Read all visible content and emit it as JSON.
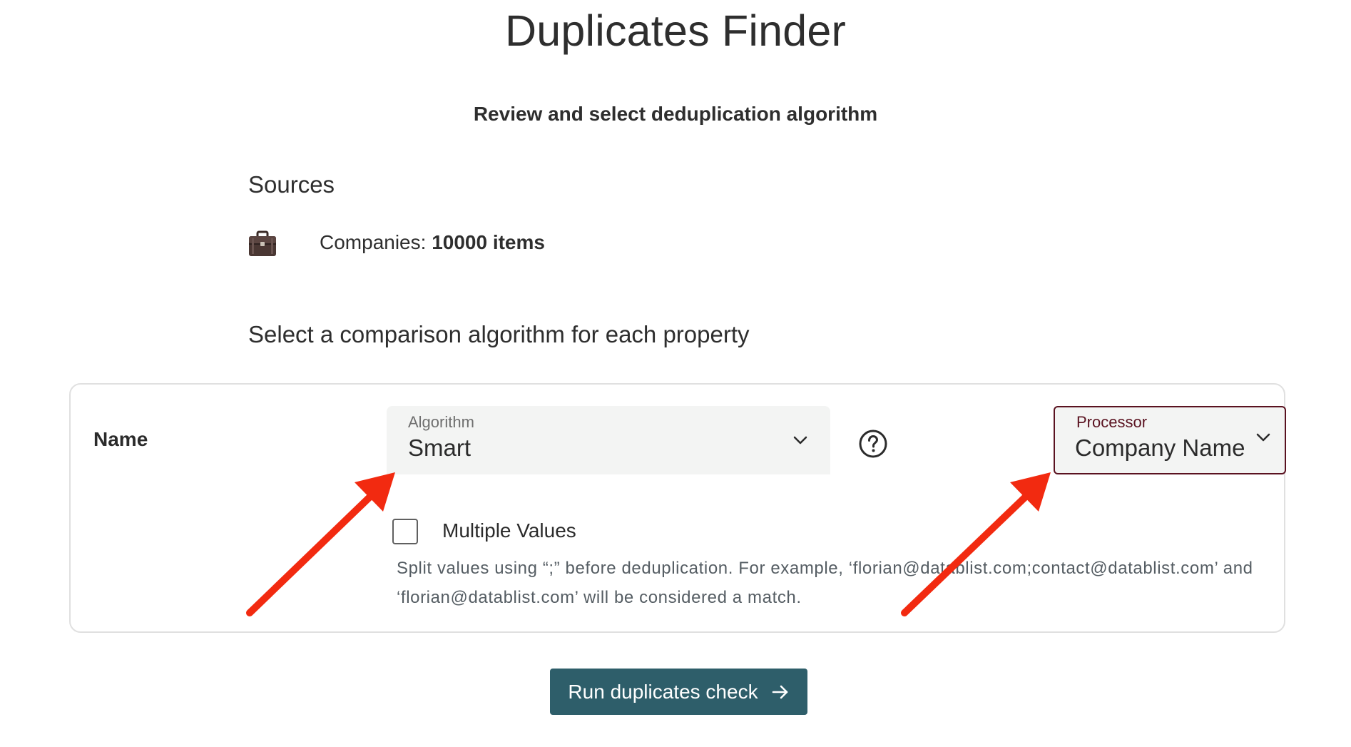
{
  "page": {
    "title": "Duplicates Finder",
    "subtitle": "Review and select deduplication algorithm"
  },
  "sources": {
    "title": "Sources",
    "items": [
      {
        "icon": "briefcase-icon",
        "label": "Companies: ",
        "count": "10000 items"
      }
    ]
  },
  "algorithm_section": {
    "title": "Select a comparison algorithm for each property"
  },
  "property": {
    "name": "Name",
    "algorithm": {
      "label": "Algorithm",
      "value": "Smart"
    },
    "processor": {
      "label": "Processor",
      "value": "Company Name",
      "border_color": "#5a1220"
    },
    "multiple_values": {
      "label": "Multiple Values",
      "checked": false,
      "help_line1": "Split values using “;” before deduplication. For example, ‘florian@datablist.com;contact@datablist.com’ and",
      "help_line2": "‘florian@datablist.com’ will be considered a match."
    }
  },
  "actions": {
    "run_label": "Run duplicates check",
    "run_color": "#2e5e6a"
  },
  "annotations": {
    "arrow_color": "#f22a10"
  }
}
